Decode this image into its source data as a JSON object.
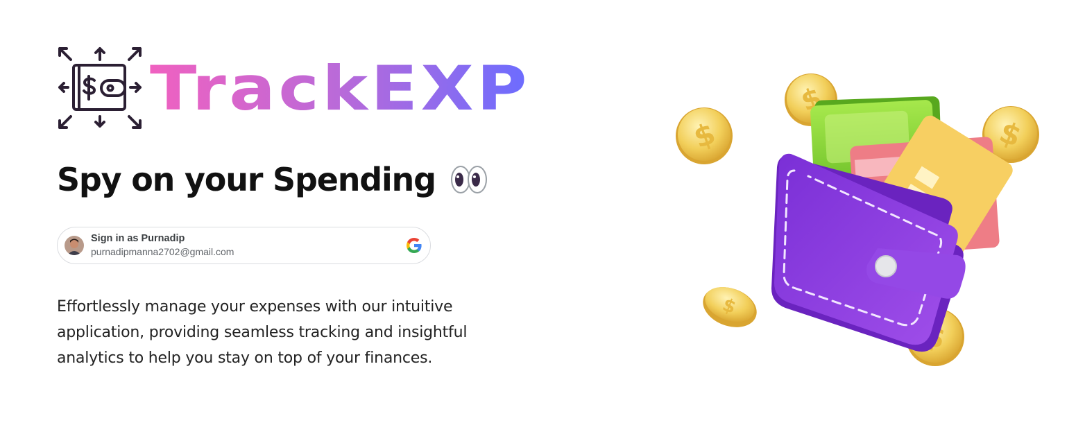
{
  "brand": {
    "name": "TrackEXP",
    "logo_icon": "wallet-with-arrows-icon",
    "gradient": [
      "#f061c0",
      "#b96ad9",
      "#6b6cff"
    ]
  },
  "hero": {
    "tagline": "Spy on your Spending",
    "tagline_emoji": "eyes-icon",
    "description_lines": [
      "Effortlessly manage your expenses with our intuitive",
      "application, providing seamless tracking and insightful",
      "analytics to help you stay on top of your finances."
    ],
    "illustration": "purple-wallet-with-cash-card-and-coins"
  },
  "google_signin": {
    "title": "Sign in as Purnadip",
    "email": "purnadipmanna2702@gmail.com",
    "provider_icon": "google-g-icon"
  },
  "colors": {
    "wallet_purple": "#8a3fe0",
    "cash_green": "#8fd83a",
    "coin_gold": "#f2c94c",
    "card_pink": "#ee7d86",
    "card_yellow": "#f7cf62"
  }
}
